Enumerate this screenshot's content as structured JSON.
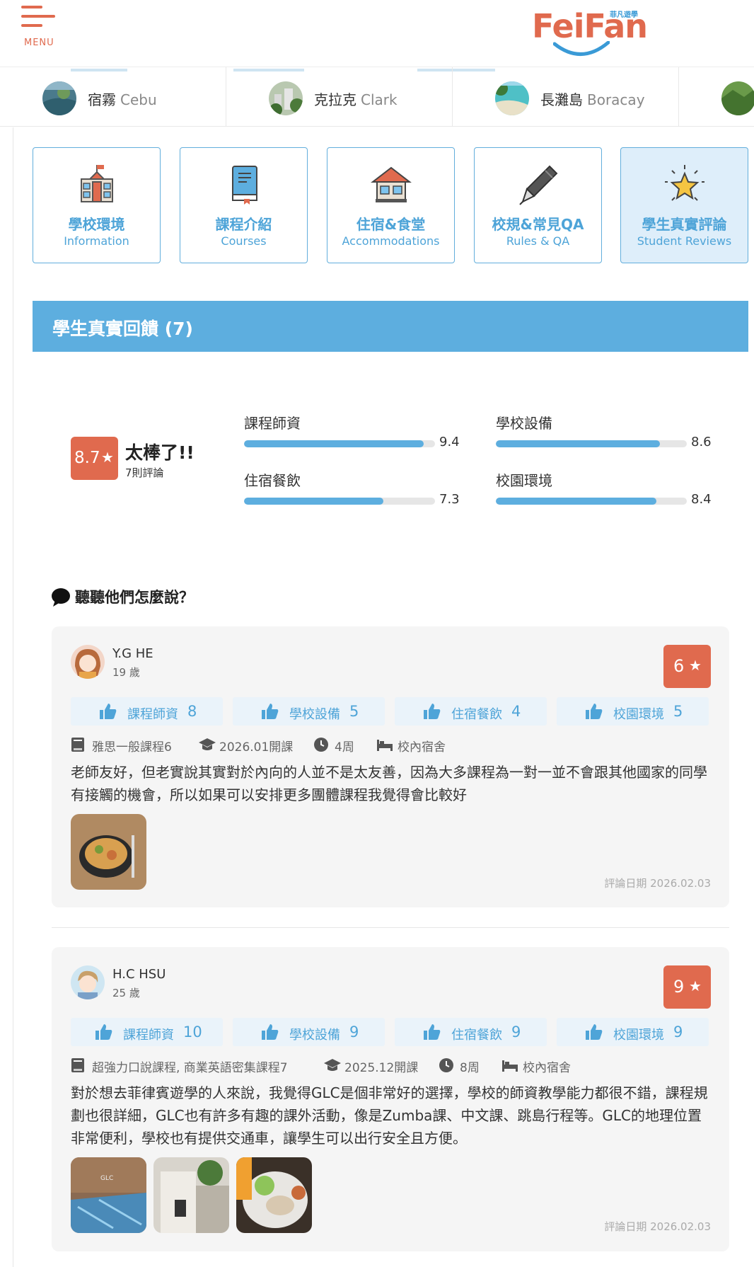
{
  "header": {
    "menu_label": "MENU",
    "logo_text": "FeiFan",
    "logo_sub": "菲凡遊學"
  },
  "regions": [
    {
      "zh": "宿霧",
      "en": "Cebu"
    },
    {
      "zh": "克拉克",
      "en": "Clark"
    },
    {
      "zh": "長灘島",
      "en": "Boracay"
    }
  ],
  "tiles": [
    {
      "zh": "學校環境",
      "en": "Information",
      "icon": "school-building-icon"
    },
    {
      "zh": "課程介紹",
      "en": "Courses",
      "icon": "book-icon"
    },
    {
      "zh": "住宿&食堂",
      "en": "Accommodations",
      "icon": "house-icon"
    },
    {
      "zh": "校規&常見QA",
      "en": "Rules & QA",
      "icon": "pen-icon"
    },
    {
      "zh": "學生真實評論",
      "en": "Student Reviews",
      "icon": "star-icon",
      "active": true
    }
  ],
  "section": {
    "title": "學生真實回饋 (7)"
  },
  "overall": {
    "score": "8.7",
    "verdict": "太棒了!!",
    "count": "7則評論",
    "ratings": [
      {
        "label": "課程師資",
        "value": 9.4
      },
      {
        "label": "學校設備",
        "value": 8.6
      },
      {
        "label": "住宿餐飲",
        "value": 7.3
      },
      {
        "label": "校園環境",
        "value": 8.4
      }
    ]
  },
  "reviews_heading": "聽聽他們怎麼說？",
  "reviews": [
    {
      "name": "Y.G HE",
      "age": "19 歲",
      "score": "6",
      "chips": [
        {
          "label": "課程師資",
          "value": "8"
        },
        {
          "label": "學校設備",
          "value": "5"
        },
        {
          "label": "住宿餐飲",
          "value": "4"
        },
        {
          "label": "校園環境",
          "value": "5"
        }
      ],
      "course": "雅思一般課程6",
      "start": "2026.01開課",
      "weeks": "4周",
      "dorm": "校內宿舍",
      "text": "老師友好，但老實說其實對於內向的人並不是太友善，因為大多課程為一對一並不會跟其他國家的同學有接觸的機會，所以如果可以安排更多團體課程我覺得會比較好",
      "date": "評論日期 2026.02.03"
    },
    {
      "name": "H.C HSU",
      "age": "25 歲",
      "score": "9",
      "chips": [
        {
          "label": "課程師資",
          "value": "10"
        },
        {
          "label": "學校設備",
          "value": "9"
        },
        {
          "label": "住宿餐飲",
          "value": "9"
        },
        {
          "label": "校園環境",
          "value": "9"
        }
      ],
      "course": "超強力口說課程, 商業英語密集課程7",
      "start": "2025.12開課",
      "weeks": "8周",
      "dorm": "校內宿舍",
      "text": "對於想去菲律賓遊學的人來說，我覺得GLC是個非常好的選擇，學校的師資教學能力都很不錯，課程規劃也很詳細，GLC也有許多有趣的課外活動，像是Zumba課、中文課、跳島行程等。GLC的地理位置非常便利，學校也有提供交通車，讓學生可以出行安全且方便。",
      "date": "評論日期 2026.02.03"
    }
  ],
  "colors": {
    "brand_orange": "#e06a4e",
    "brand_blue": "#5daedf",
    "chip_bg": "#eaf3fa"
  }
}
